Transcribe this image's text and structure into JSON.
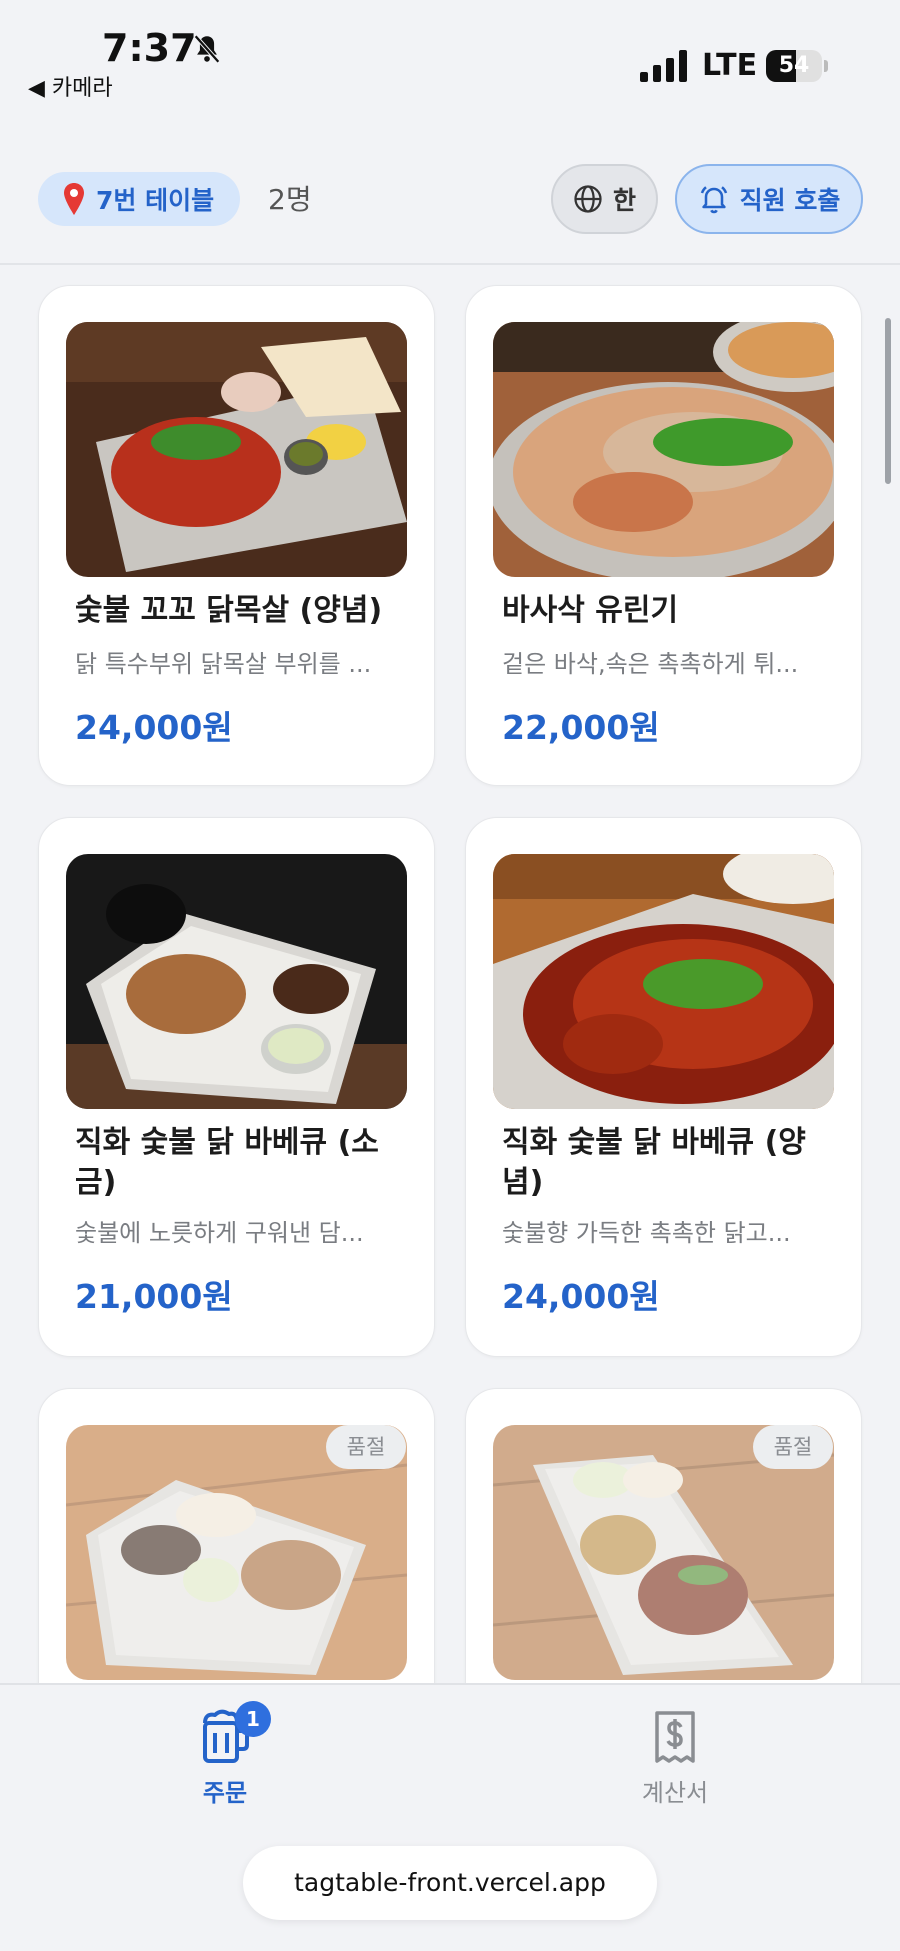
{
  "status_bar": {
    "time": "7:37",
    "back_app": "◀ 카메라",
    "network": "LTE",
    "battery_level": "54",
    "battery_fraction": 0.54
  },
  "header": {
    "table_label": "7번 테이블",
    "guests": "2명",
    "language_label": "한",
    "call_staff_label": "직원 호출"
  },
  "menu": {
    "items": [
      {
        "name": "숯불 꼬꼬 닭목살 (양념)",
        "description": "닭 특수부위 닭목살 부위를 ...",
        "price": "24,000원"
      },
      {
        "name": "바사삭 유린기",
        "description": "겉은 바삭,속은 촉촉하게 튀...",
        "price": "22,000원"
      },
      {
        "name": "직화 숯불 닭 바베큐 (소금)",
        "description": "숯불에 노릇하게 구워낸 담...",
        "price": "21,000원"
      },
      {
        "name": "직화 숯불 닭 바베큐 (양념)",
        "description": "숯불향 가득한 촉촉한 닭고...",
        "price": "24,000원"
      },
      {
        "soldout_label": "품절"
      },
      {
        "soldout_label": "품절"
      }
    ]
  },
  "bottom_nav": {
    "order_label": "주문",
    "order_badge": "1",
    "bill_label": "계산서"
  },
  "url_bar": "tagtable-front.vercel.app",
  "colors": {
    "accent": "#2463c9",
    "accent_light": "#d6e6fb",
    "background": "#f2f3f6",
    "muted": "#8a8d92"
  }
}
